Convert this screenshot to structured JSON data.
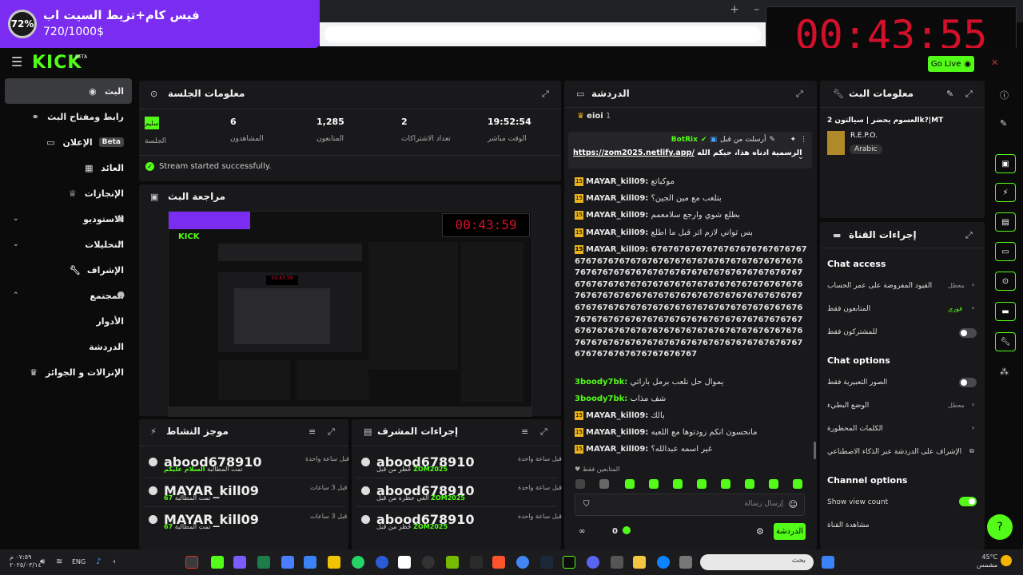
{
  "overlay": {
    "goal_percent": "72%",
    "goal_title": "فيس كام+تزيط السيت اب",
    "goal_count": "720/1000$",
    "timer": "00:43:55"
  },
  "header": {
    "logo": "KICK",
    "logo_beta": "BETA",
    "go_live": "Go Live"
  },
  "sidebar": {
    "items": [
      {
        "label": "البث",
        "icon": "broadcast-icon"
      },
      {
        "label": "رابط ومفتاح البث",
        "icon": "link-icon"
      },
      {
        "label": "الإعلان",
        "icon": "ads-icon",
        "badge": "Beta"
      },
      {
        "label": "العائد",
        "icon": "revenue-icon"
      },
      {
        "label": "الإنجازات",
        "icon": "trophy-icon"
      },
      {
        "label": "الاستوديو",
        "icon": "studio-icon"
      },
      {
        "label": "التحليلات",
        "icon": "analytics-icon"
      },
      {
        "label": "الإشراف",
        "icon": "moderation-icon"
      },
      {
        "label": "المجتمع",
        "icon": "community-icon"
      },
      {
        "label": "الأدوار",
        "icon": ""
      },
      {
        "label": "الدردشة",
        "icon": ""
      },
      {
        "label": "الإنزالات و الجوائز",
        "icon": "drops-icon"
      }
    ]
  },
  "session": {
    "title": "معلومات الجلسة",
    "health": "سليم",
    "health_label": "الجلسة",
    "viewers": "6",
    "viewers_label": "المشاهدون",
    "followers": "1,285",
    "followers_label": "المتابعون",
    "subs": "2",
    "subs_label": "تعداد الاشتراكات",
    "live_time": "19:52:54",
    "live_time_label": "الوقت مباشر",
    "status_message": "Stream started successfully."
  },
  "preview": {
    "title": "مراجعة البث",
    "inner_timer": "00:43:59"
  },
  "activity": {
    "title": "موجز النشاط",
    "rows": [
      {
        "name": "abood678910",
        "action": "تمت المطالبة",
        "detail": "السلام عليكم",
        "time": "قبل ساعة واحدة"
      },
      {
        "name": "MAYAR_kill09",
        "action": "تمت المطالبة",
        "detail": "67",
        "time": "قبل 3 ساعات"
      },
      {
        "name": "MAYAR_kill09",
        "action": "تمت المطالبة",
        "detail": "67",
        "time": "قبل 3 ساعات"
      }
    ]
  },
  "modactions": {
    "title": "إجراءات المشرف",
    "rows": [
      {
        "name": "abood678910",
        "action": "حُظر من قبل",
        "detail": "ZOM2025",
        "time": "قبل ساعة واحدة"
      },
      {
        "name": "abood678910",
        "action": "ألغي حظره من قبل",
        "detail": "ZOM2025",
        "time": "قبل ساعة واحدة"
      },
      {
        "name": "abood678910",
        "action": "حُظر من قبل",
        "detail": "ZOM2025",
        "time": "قبل ساعة واحدة"
      }
    ]
  },
  "chat": {
    "title": "الدردشة",
    "top_user": "eioi",
    "top_count": "1",
    "pinned_by": "أرسلت من قبل",
    "pinned_user": "BotRix",
    "pinned_text": "جميع حساباتي الرسمية ادناه هذا، حيكم الله:",
    "pinned_link": "https://zom2025.netlify.app/",
    "messages": [
      {
        "user": "MAYAR_kill09:",
        "text": "موكباتع",
        "badge": "15"
      },
      {
        "user": "MAYAR_kill09:",
        "text": "بتلعب مع مين الجين؟",
        "badge": "15"
      },
      {
        "user": "MAYAR_kill09:",
        "text": "بطلع شوي وارجع سلامعمم",
        "badge": "15"
      },
      {
        "user": "MAYAR_kill09:",
        "text": "بس ثواني لازم اثر قبل ما اطلع",
        "badge": "15"
      },
      {
        "user": "MAYAR_kill09:",
        "text": "676767676767676767676767676767676767676767676767676767676767676767676767676767676767676767676767676767676767676767676767676767676767676767676767676767676767676767676767676767676767676767676767676767676767676767676767676767676767676767676767676767676767676767676767676767676767676767676767676767676767676767676767676767676767676767676767676767676767676767676767676767676767676767",
        "badge": "15"
      },
      {
        "user": "3boody7bk:",
        "text": "يموال حل نلعب برمل باراتي",
        "badge": ""
      },
      {
        "user": "3boody7bk:",
        "text": "شف مذاب",
        "badge": ""
      },
      {
        "user": "MAYAR_kill09:",
        "text": "بالك",
        "badge": "15"
      },
      {
        "user": "MAYAR_kill09:",
        "text": "مانحسون انكم زودتوها مع اللعبه",
        "badge": "15"
      },
      {
        "user": "MAYAR_kill09:",
        "text": "غير اسمه عبدالله؟",
        "badge": "15"
      }
    ],
    "followers_only": "المتابعين فقط",
    "input_placeholder": "إرسال رسالة",
    "count": "0",
    "send": "الدردشة"
  },
  "stream_info": {
    "title": "معلومات البث",
    "stream_title": "العسوم يحضر | سيالتون 2k?|MT",
    "category": "R.E.P.O.",
    "language": "Arabic"
  },
  "channel_actions": {
    "title": "إجراءات القناة",
    "chat_access": "Chat access",
    "account_age": "القيود المفروضة على عمر الحساب",
    "account_age_val": "معطل",
    "followers_only": "المتابعون فقط",
    "followers_only_val": "فوري",
    "subs_only": "للمشتركون فقط",
    "chat_options": "Chat options",
    "emote_only": "الصور التعبيرية فقط",
    "slow_mode": "الوضع البطيء",
    "slow_mode_val": "معطل",
    "banned_words": "الكلمات المحظورة",
    "ai_mod": "الإشراف على الدردشة عبر الذكاء الاصطناعي",
    "channel_options": "Channel options",
    "show_view_count": "Show view count",
    "share_channel": "مشاهدة القناة"
  },
  "taskbar": {
    "search": "بحث",
    "lang": "ENG",
    "time": "٠٧:٥٩ م",
    "date": "٢٠٢٥/٠٣/١٤",
    "weather_temp": "45°C",
    "weather": "مشمس"
  },
  "colors": {
    "accent": "#53fc18",
    "panel": "#19191b",
    "goal": "#7a2cf0",
    "timer": "#d3102a"
  }
}
